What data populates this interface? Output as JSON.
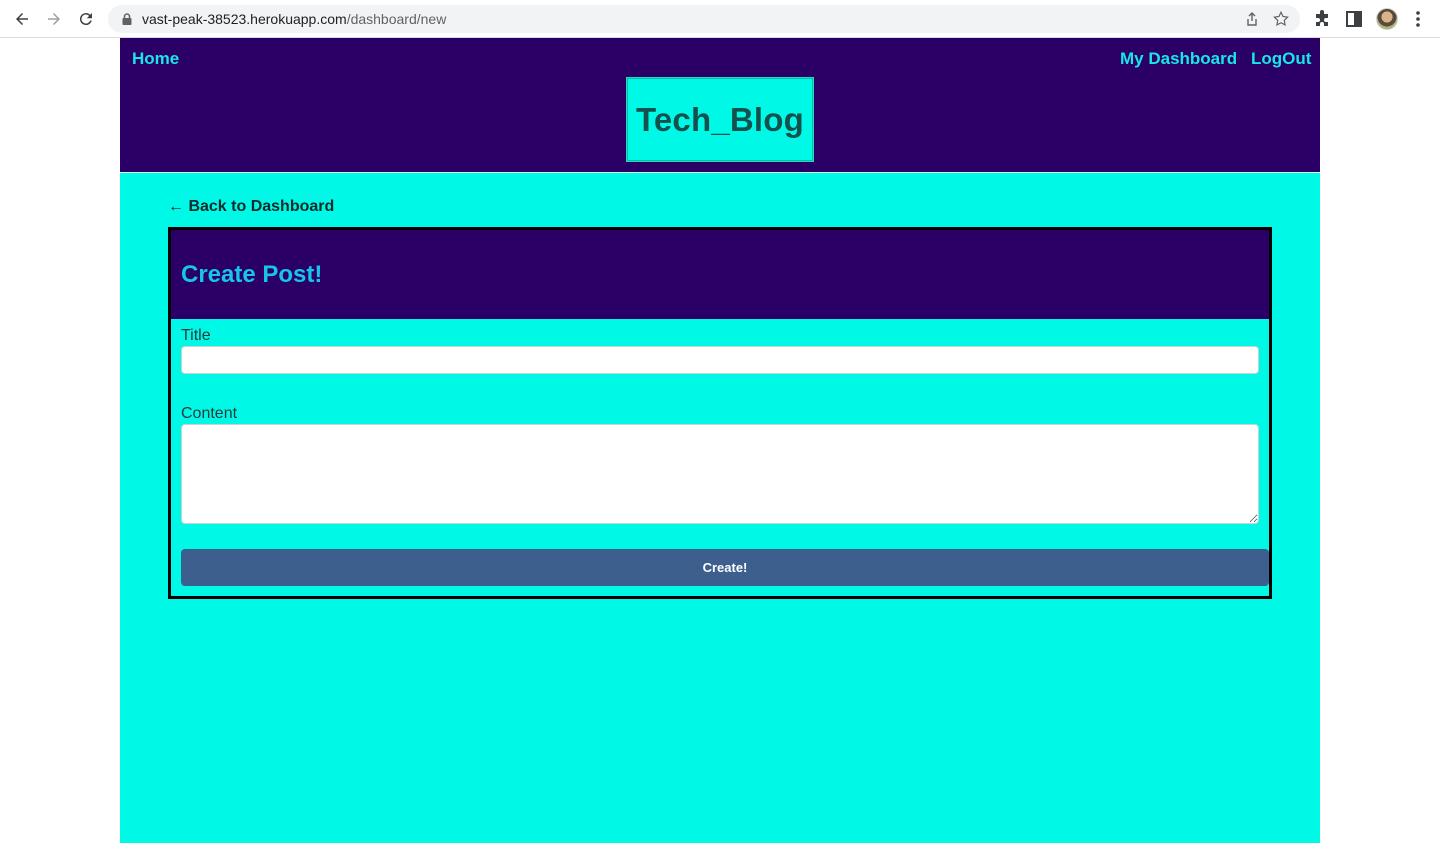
{
  "browser": {
    "url_host": "vast-peak-38523.herokuapp.com",
    "url_path": "/dashboard/new"
  },
  "nav": {
    "home": "Home",
    "dashboard": "My Dashboard",
    "logout": "LogOut"
  },
  "brand": "Tech_Blog",
  "back_link": "← Back to Dashboard",
  "form": {
    "heading": "Create Post!",
    "title_label": "Title",
    "title_value": "",
    "content_label": "Content",
    "content_value": "",
    "submit_label": "Create!"
  },
  "colors": {
    "header_bg": "#2b0066",
    "page_bg": "#00f9e6",
    "nav_link": "#19e6e6",
    "button_bg": "#3c5f8e"
  },
  "icons": [
    "back-arrow-icon",
    "forward-arrow-icon",
    "reload-icon",
    "lock-icon",
    "share-icon",
    "star-icon",
    "extensions-icon",
    "sidebar-icon",
    "menu-dots-icon"
  ]
}
